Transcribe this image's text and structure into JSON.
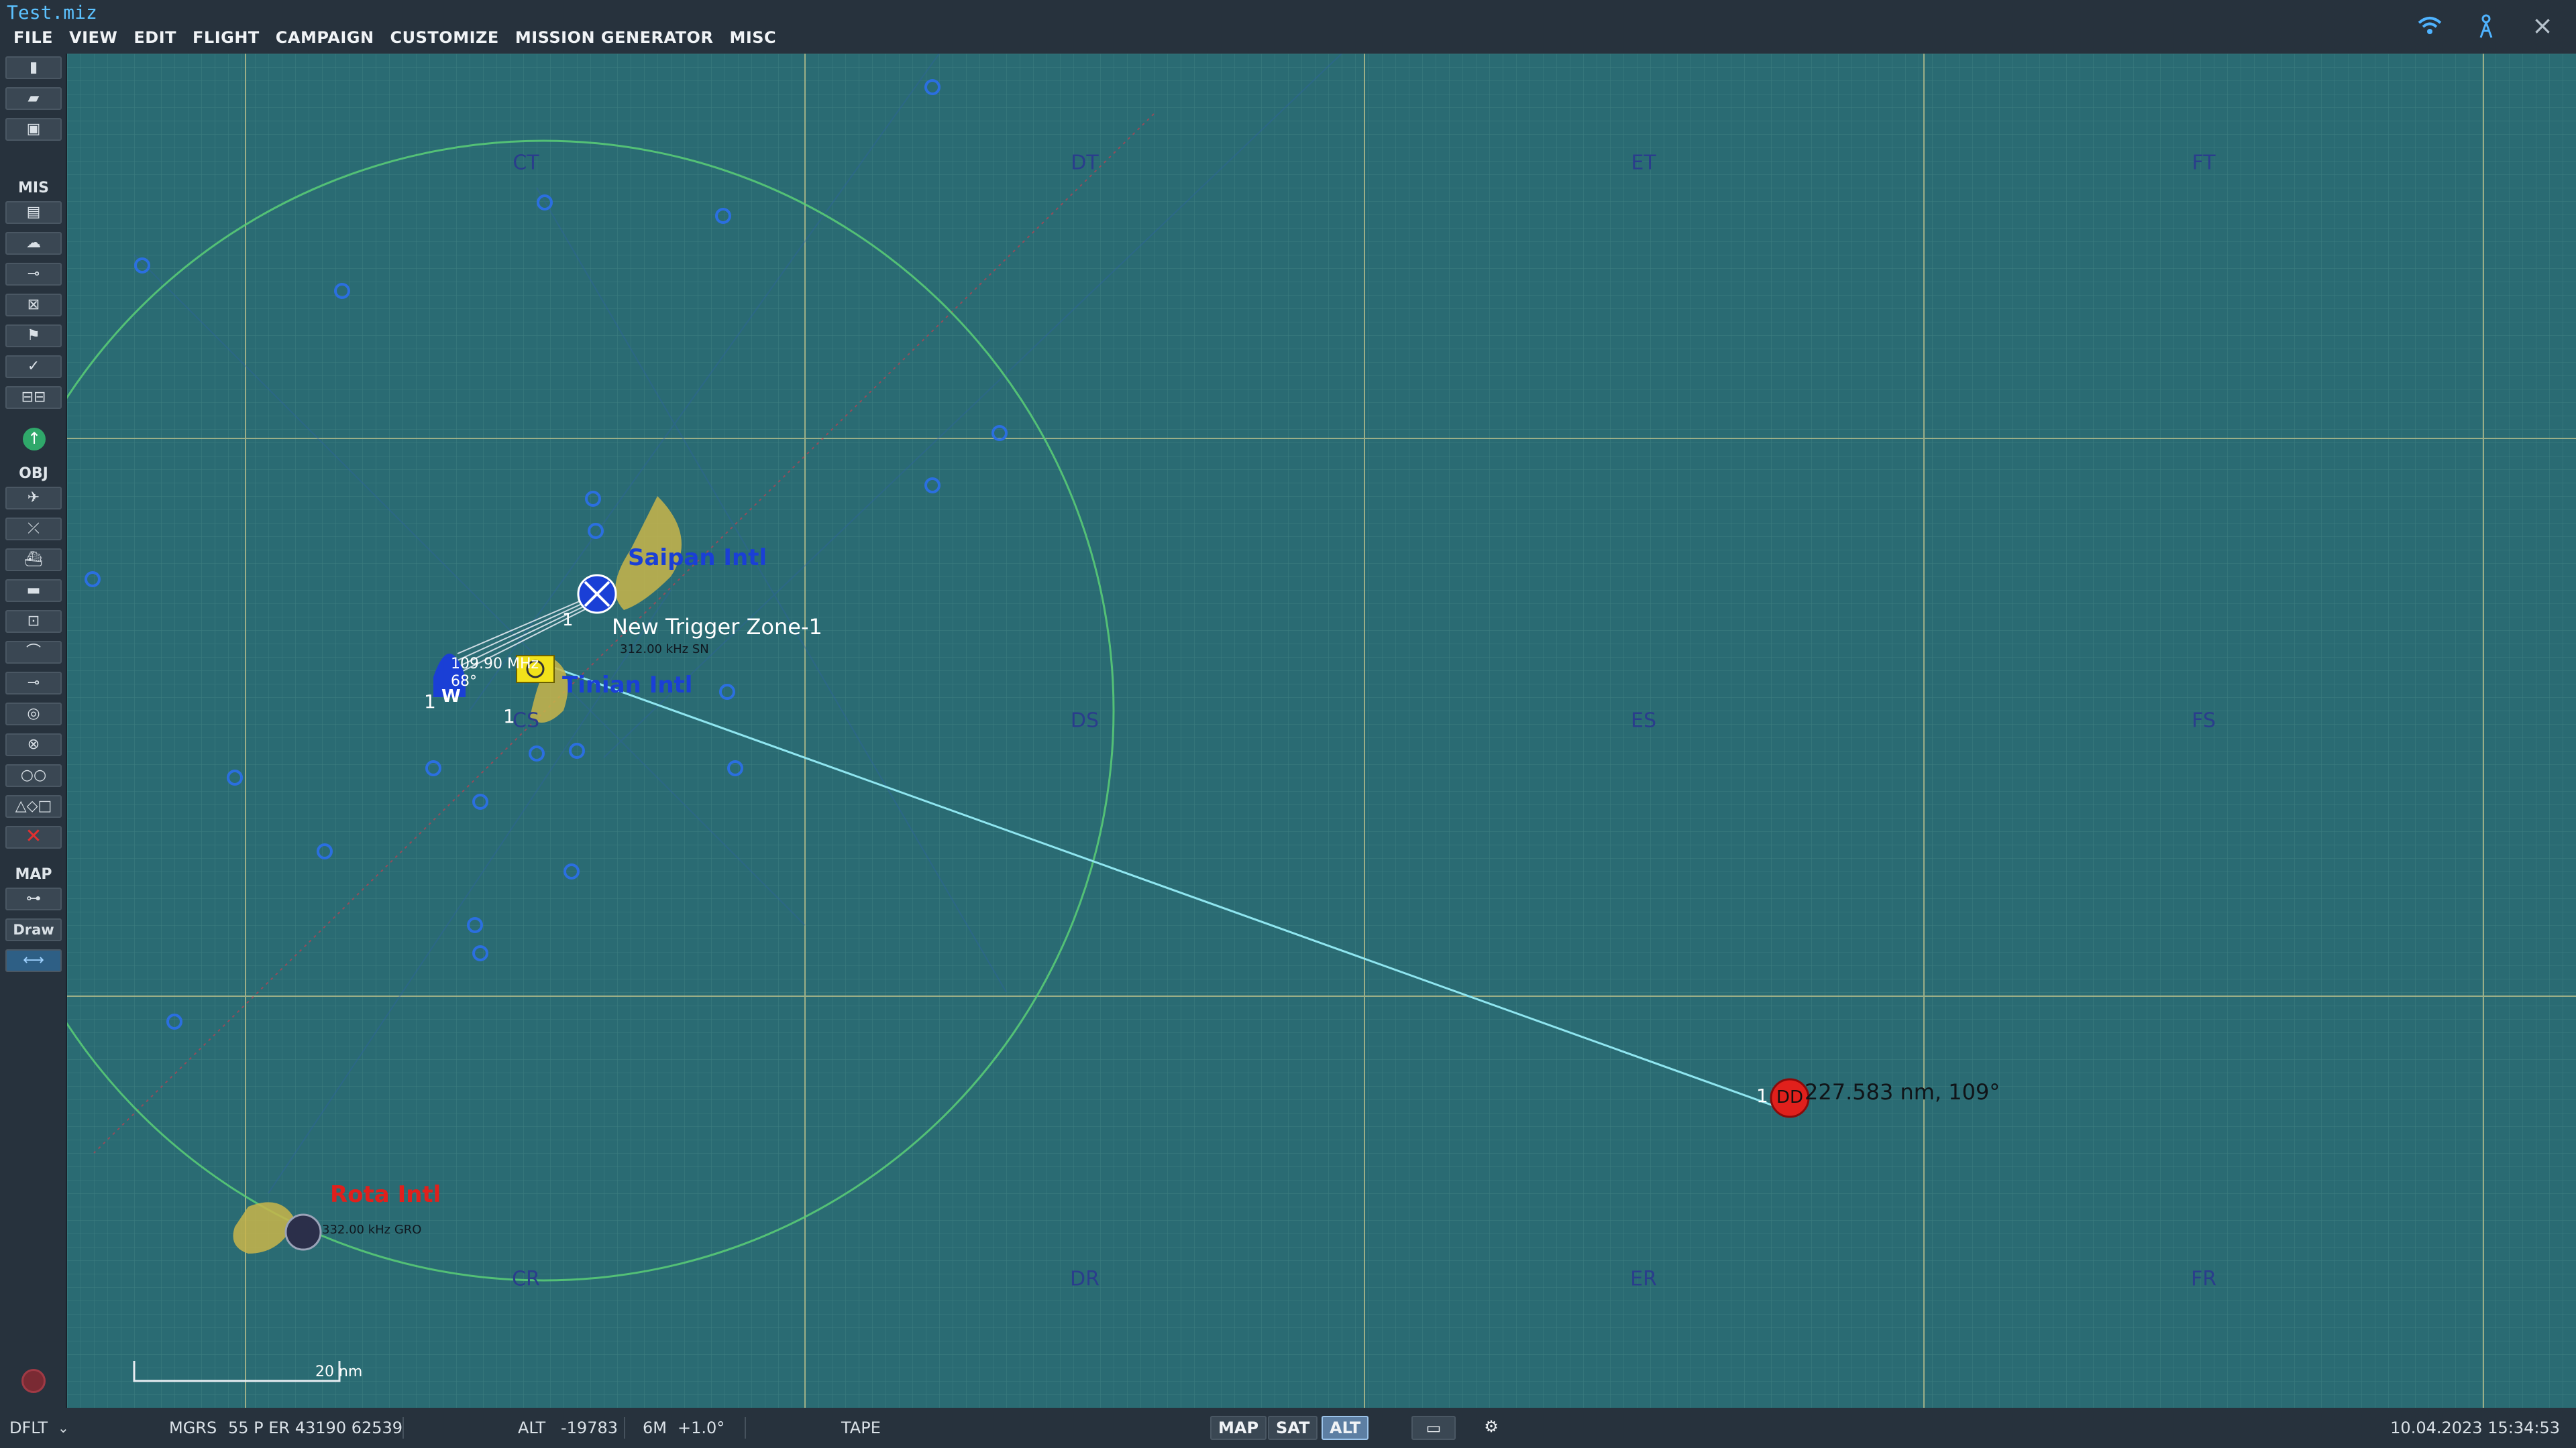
{
  "window": {
    "title": "Test.miz"
  },
  "menu": [
    "FILE",
    "VIEW",
    "EDIT",
    "FLIGHT",
    "CAMPAIGN",
    "CUSTOMIZE",
    "MISSION GENERATOR",
    "MISC"
  ],
  "title_icons": {
    "wifi": "wifi-icon",
    "antenna": "antenna-icon",
    "close": "×"
  },
  "toolbar": {
    "sections": {
      "mis": "MIS",
      "obj": "OBJ",
      "map": "MAP"
    },
    "draw_label": "Draw",
    "icons": {
      "new_file": "file-new-icon",
      "open": "folder-open-icon",
      "save": "save-icon",
      "briefing": "clipboard-icon",
      "weather": "cloud-icon",
      "route": "route-icon",
      "trigger": "trigger-icon",
      "mission_goals": "flag-icon",
      "check": "check-icon",
      "failures": "failures-icon",
      "up": "arrow-up-icon",
      "plane": "plane-icon",
      "helicopter": "helicopter-icon",
      "ship": "ship-icon",
      "vehicle": "vehicle-icon",
      "static": "static-object-icon",
      "bridge": "bridge-icon",
      "waypoint": "waypoint-icon",
      "target": "target-icon",
      "cross_circle": "cross-circle-icon",
      "template": "template-icon",
      "shapes": "shapes-icon",
      "delete": "delete-icon",
      "ruler": "ruler-icon",
      "tape": "tape-icon",
      "record": "record-icon"
    }
  },
  "map": {
    "grid_labels": [
      "CT",
      "DT",
      "ET",
      "FT",
      "CS",
      "DS",
      "ES",
      "FS",
      "CR",
      "DR",
      "ER",
      "FR"
    ],
    "labels": {
      "saipan": "Saipan Intl",
      "tinian": "Tinian Intl",
      "rota": "Rota Intl",
      "trigger_zone": "New Trigger Zone-1",
      "saipan_freq": "312.00 kHz SN",
      "tinian_freq": "109.90 MHz",
      "tinian_heading": "68°",
      "rota_freq": "332.00 kHz GRO",
      "measure": "227.583 nm, 109°",
      "scale": "20 nm",
      "unit_one_a": "1",
      "unit_one_b": "1",
      "unit_one_c": "1",
      "unit_one_d": "1",
      "waypoint_letter": "W",
      "red_unit": "DD"
    },
    "colors": {
      "sea": "#2a6b73",
      "grid_major": "#a9b78a",
      "blue": "#1a3fd6",
      "red": "#e0201c",
      "yellow": "#f2e21a",
      "measure_line": "#8fe6f0",
      "circle": "#5bcf77"
    }
  },
  "statusbar": {
    "profile": "DFLT",
    "coord_type": "MGRS",
    "coord_value": "55 P ER 43190 62539",
    "alt_label": "ALT",
    "alt_value": "-19783",
    "zoom": "6M",
    "magvar": "+1.0°",
    "tape": "TAPE",
    "map_btn": "MAP",
    "sat_btn": "SAT",
    "alt_btn": "ALT",
    "datetime": "10.04.2023 15:34:53"
  }
}
